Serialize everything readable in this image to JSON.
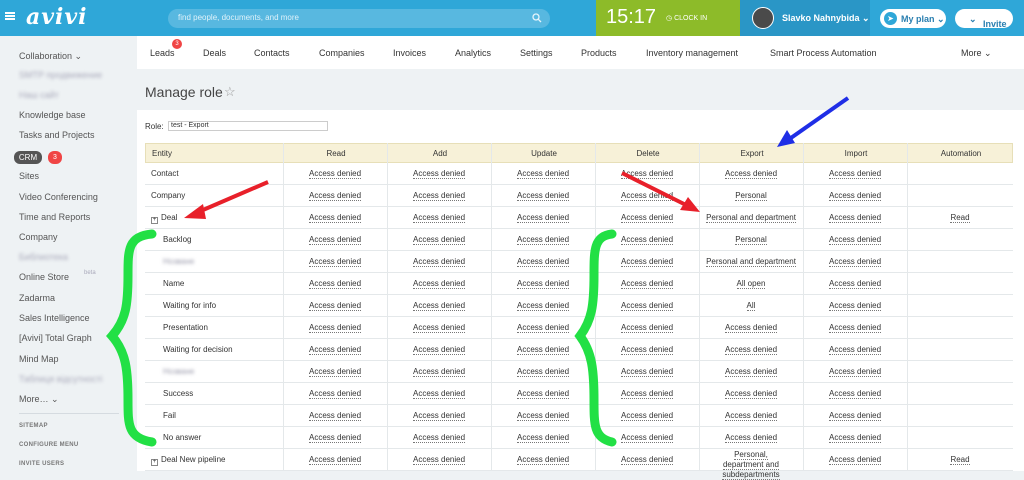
{
  "header": {
    "logo": "avivi",
    "search_placeholder": "find people, documents, and more",
    "time": "15:17",
    "clock_in": "CLOCK IN",
    "user_name": "Slavko Nahnybida",
    "my_plan": "My plan",
    "invite": "Invite"
  },
  "sidebar": {
    "items": [
      "Collaboration ⌄",
      "SMTP продвижение",
      "Наш сайт",
      "Knowledge base",
      "Tasks and Projects",
      "",
      "Sites",
      "Video Conferencing",
      "Time and Reports",
      "Company",
      "Библиотека",
      "Online Store",
      "Zadarma",
      "Sales Intelligence",
      "[Avivi] Total Graph",
      "Mind Map",
      "Таблиця відсутності",
      "More… ⌄"
    ],
    "crm_label": "CRM",
    "crm_count": "3",
    "online_store_suffix": "beta",
    "footer": [
      "SITEMAP",
      "CONFIGURE MENU",
      "INVITE USERS"
    ]
  },
  "nav": {
    "tabs": [
      "Leads",
      "Deals",
      "Contacts",
      "Companies",
      "Invoices",
      "Analytics",
      "Settings",
      "Products",
      "Inventory management",
      "Smart Process Automation",
      "More ⌄"
    ],
    "leads_badge": "3"
  },
  "page": {
    "title": "Manage role",
    "role_label": "Role:",
    "role_value": "test - Export"
  },
  "table": {
    "headers": [
      "Entity",
      "Read",
      "Add",
      "Update",
      "Delete",
      "Export",
      "Import",
      "Automation"
    ],
    "rows": [
      {
        "entity": "Contact",
        "cells": [
          "Access denied",
          "Access denied",
          "Access denied",
          "Access denied",
          "Access denied",
          "Access denied",
          ""
        ]
      },
      {
        "entity": "Company",
        "cells": [
          "Access denied",
          "Access denied",
          "Access denied",
          "Access denied",
          "Personal",
          "Access denied",
          ""
        ]
      },
      {
        "entity": "Deal",
        "cells": [
          "Access denied",
          "Access denied",
          "Access denied",
          "Access denied",
          "Personal and department",
          "Access denied",
          "Read"
        ]
      },
      {
        "entity": "Backlog",
        "cells": [
          "Access denied",
          "Access denied",
          "Access denied",
          "Access denied",
          "Personal",
          "Access denied",
          ""
        ]
      },
      {
        "entity": "Нoзванe",
        "cells": [
          "Access denied",
          "Access denied",
          "Access denied",
          "Access denied",
          "Personal and department",
          "Access denied",
          ""
        ]
      },
      {
        "entity": "Name",
        "cells": [
          "Access denied",
          "Access denied",
          "Access denied",
          "Access denied",
          "All open",
          "Access denied",
          ""
        ]
      },
      {
        "entity": "Waiting for info",
        "cells": [
          "Access denied",
          "Access denied",
          "Access denied",
          "Access denied",
          "All",
          "Access denied",
          ""
        ]
      },
      {
        "entity": "Presentation",
        "cells": [
          "Access denied",
          "Access denied",
          "Access denied",
          "Access denied",
          "Access denied",
          "Access denied",
          ""
        ]
      },
      {
        "entity": "Waiting for decision",
        "cells": [
          "Access denied",
          "Access denied",
          "Access denied",
          "Access denied",
          "Access denied",
          "Access denied",
          ""
        ]
      },
      {
        "entity": "Нoзванe",
        "cells": [
          "Access denied",
          "Access denied",
          "Access denied",
          "Access denied",
          "Access denied",
          "Access denied",
          ""
        ]
      },
      {
        "entity": "Success",
        "cells": [
          "Access denied",
          "Access denied",
          "Access denied",
          "Access denied",
          "Access denied",
          "Access denied",
          ""
        ]
      },
      {
        "entity": "Fail",
        "cells": [
          "Access denied",
          "Access denied",
          "Access denied",
          "Access denied",
          "Access denied",
          "Access denied",
          ""
        ]
      },
      {
        "entity": "No answer",
        "cells": [
          "Access denied",
          "Access denied",
          "Access denied",
          "Access denied",
          "Access denied",
          "Access denied",
          ""
        ]
      },
      {
        "entity": "Deal New pipeline",
        "cells": [
          "Access denied",
          "Access denied",
          "Access denied",
          "Access denied",
          "Personal, department and subdepartments",
          "Access denied",
          "Read"
        ]
      }
    ]
  },
  "annotation_colors": {
    "red_arrow": "#e8202a",
    "blue_arrow": "#1f2ee6",
    "green_brace": "#22e045"
  }
}
